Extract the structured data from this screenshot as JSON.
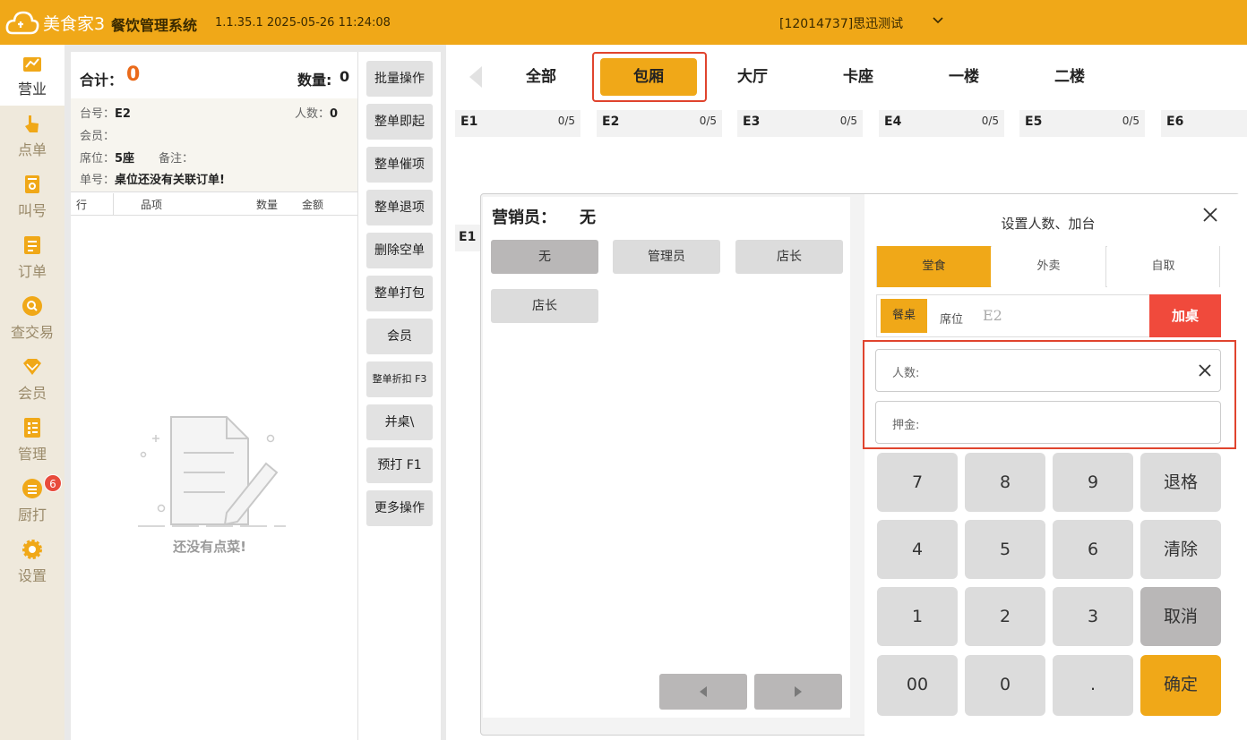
{
  "header": {
    "logo_text": "美食家3",
    "system_title": "餐饮管理系统",
    "version": "1.1.35.1 2025-05-26 11:24:08",
    "store": "[12014737]思迅测试",
    "accent_color": "#f0a818"
  },
  "nav": {
    "items": [
      {
        "label": "营业",
        "icon": "chart-icon",
        "active": true
      },
      {
        "label": "点单",
        "icon": "hand-pointer-icon"
      },
      {
        "label": "叫号",
        "icon": "ticket-icon"
      },
      {
        "label": "订单",
        "icon": "list-icon"
      },
      {
        "label": "查交易",
        "icon": "search-icon"
      },
      {
        "label": "会员",
        "icon": "diamond-icon"
      },
      {
        "label": "管理",
        "icon": "checklist-icon"
      },
      {
        "label": "厨打",
        "icon": "printer-icon",
        "badge": "6"
      },
      {
        "label": "设置",
        "icon": "gear-icon"
      }
    ]
  },
  "order": {
    "total_label": "合计：",
    "total_value": "0",
    "qty_label": "数量:",
    "qty_value": "0",
    "table_label": "台号：",
    "table_value": "E2",
    "people_label": "人数：",
    "people_value": "0",
    "member_label": "会员：",
    "seat_label": "席位：",
    "seat_value": "5座",
    "remark_label": "备注：",
    "bill_label": "单号：",
    "bill_value": "桌位还没有关联订单!",
    "columns": [
      "行",
      "品项",
      "数量",
      "金额"
    ],
    "empty_text": "还没有点菜!"
  },
  "actions": [
    "批量操作",
    "整单即起",
    "整单催项",
    "整单退项",
    "删除空单",
    "整单打包",
    "会员",
    "整单折扣 F3",
    "并桌\\",
    "预打 F1",
    "更多操作"
  ],
  "areas": {
    "tabs": [
      "全部",
      "包厢",
      "大厅",
      "卡座",
      "一楼",
      "二楼"
    ],
    "active": "包厢"
  },
  "tables": [
    {
      "name": "E1",
      "count": "0/5"
    },
    {
      "name": "E2",
      "count": "0/5"
    },
    {
      "name": "E3",
      "count": "0/5"
    },
    {
      "name": "E4",
      "count": "0/5"
    },
    {
      "name": "E5",
      "count": "0/5"
    },
    {
      "name": "E6",
      "count": ""
    }
  ],
  "second_row_label": "E1",
  "dialog": {
    "sales_label": "营销员：",
    "sales_value": "无",
    "salespeople": [
      "无",
      "管理员",
      "店长",
      "店长"
    ],
    "title": "设置人数、加台",
    "modes": [
      "堂食",
      "外卖",
      "自取"
    ],
    "active_mode": "堂食",
    "meal_label": "餐桌",
    "seat_label": "席位",
    "seat_value": "E2",
    "add_table_label": "加桌",
    "people_field": "人数:",
    "deposit_field": "押金:",
    "keys": [
      [
        "7",
        "8",
        "9",
        "退格"
      ],
      [
        "4",
        "5",
        "6",
        "清除"
      ],
      [
        "1",
        "2",
        "3",
        "取消"
      ],
      [
        "00",
        "0",
        ".",
        "确定"
      ]
    ]
  }
}
